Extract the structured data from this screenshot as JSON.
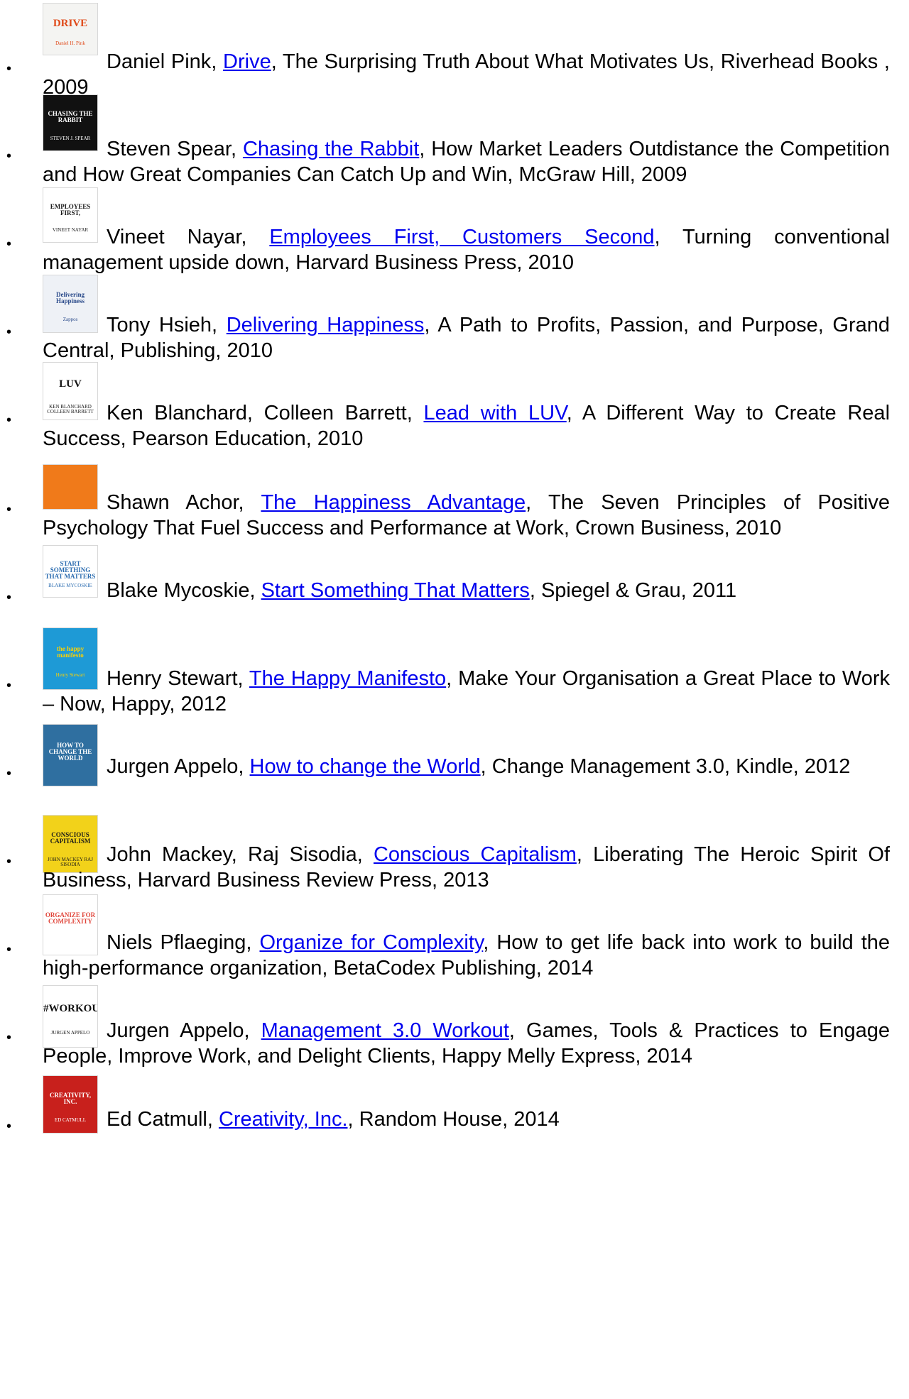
{
  "books": [
    {
      "author": "Daniel Pink, ",
      "title": "Drive",
      "rest": ", The Surprising Truth About What Motivates Us, Riverhead Books , 2009",
      "cover": {
        "text": "DRIVE",
        "sub": "Daniel H. Pink",
        "bg": "#f4f4f2",
        "fg": "#e04a1a"
      }
    },
    {
      "author": "Steven Spear, ",
      "title": "Chasing the Rabbit",
      "rest": ", How Market Leaders Outdistance the Competition and How Great Companies Can Catch Up and Win, McGraw Hill, 2009",
      "cover": {
        "text": "CHASING THE RABBIT",
        "sub": "STEVEN J. SPEAR",
        "bg": "#111111",
        "fg": "#ffffff"
      }
    },
    {
      "author": "Vineet Nayar, ",
      "title": "Employees First, Customers Second",
      "rest": ", Turning conventional management upside down, Harvard Business Press, 2010",
      "cover": {
        "text": "EMPLOYEES FIRST,",
        "sub": "VINEET NAYAR",
        "bg": "#ffffff",
        "fg": "#1a1a1a"
      }
    },
    {
      "author": "Tony Hsieh, ",
      "title": "Delivering Happiness",
      "rest": ", A Path to Profits, Passion, and Purpose, Grand Central, Publishing, 2010",
      "cover": {
        "text": "Delivering Happiness",
        "sub": "Zappos",
        "bg": "#eef1f6",
        "fg": "#2a4a8a"
      }
    },
    {
      "author": "Ken Blanchard, Colleen Barrett, ",
      "title": "Lead with LUV",
      "rest": ", A Different Way to Create Real Success, Pearson Education, 2010",
      "cover": {
        "text": "LUV",
        "sub": "KEN BLANCHARD COLLEEN BARRETT",
        "bg": "#ffffff",
        "fg": "#111111"
      }
    },
    {
      "author": "Shawn Achor, ",
      "title": "The Happiness Advantage",
      "rest": ", The Seven Principles of Positive Psychology That Fuel Success and Performance at Work, Crown Business, 2010",
      "cover": {
        "text": "",
        "sub": "",
        "bg": "#f07a1a",
        "fg": "#ffffff"
      }
    },
    {
      "author": "Blake Mycoskie, ",
      "title": "Start Something That Matters",
      "rest": ", Spiegel & Grau, 2011",
      "cover": {
        "text": "START SOMETHING THAT MATTERS",
        "sub": "BLAKE MYCOSKIE",
        "bg": "#ffffff",
        "fg": "#2b6cb0"
      }
    },
    {
      "author": "Henry Stewart, ",
      "title": "The Happy Manifesto",
      "rest": ", Make Your Organisation a Great Place to Work – Now, Happy, 2012",
      "cover": {
        "text": "the happy manifesto",
        "sub": "Henry Stewart",
        "bg": "#1e9ad6",
        "fg": "#ffd200"
      }
    },
    {
      "author": "Jurgen Appelo, ",
      "title": "How to change the World",
      "rest": ", Change Management 3.0, Kindle, 2012",
      "cover": {
        "text": "HOW TO CHANGE THE WORLD",
        "sub": "",
        "bg": "#2f6fa0",
        "fg": "#ffffff"
      }
    },
    {
      "author": "John Mackey, Raj Sisodia, ",
      "title": "Conscious Capitalism",
      "rest": ", Liberating The Heroic Spirit Of Business, Harvard Business Review Press, 2013",
      "cover": {
        "text": "CONSCIOUS CAPITALISM",
        "sub": "JOHN MACKEY RAJ SISODIA",
        "bg": "#f2d21a",
        "fg": "#1a1a1a"
      }
    },
    {
      "author": "Niels Pflaeging, ",
      "title": "Organize for Complexity",
      "rest": ", How to get life back into work to build the high-performance organization, BetaCodex Publishing, 2014",
      "cover": {
        "text": "ORGANIZE FOR COMPLEXITY",
        "sub": "",
        "bg": "#ffffff",
        "fg": "#e0453a"
      }
    },
    {
      "author": "Jurgen Appelo, ",
      "title": "Management 3.0 Workout",
      "rest": ", Games, Tools & Practices to Engage People, Improve Work, and Delight Clients, Happy Melly Express, 2014",
      "cover": {
        "text": "#WORKOUT",
        "sub": "JURGEN APPELO",
        "bg": "#ffffff",
        "fg": "#111111"
      }
    },
    {
      "author": "Ed Catmull, ",
      "title": "Creativity, Inc.",
      "rest": ", Random House, 2014",
      "cover": {
        "text": "CREATIVITY, INC.",
        "sub": "ED CATMULL",
        "bg": "#c8201c",
        "fg": "#ffffff"
      }
    }
  ]
}
